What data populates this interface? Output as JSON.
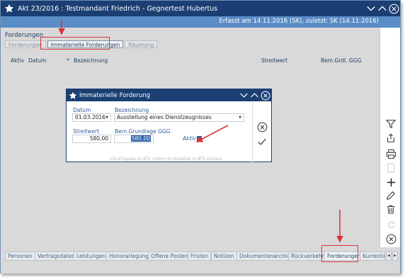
{
  "window": {
    "title": "Akt 23/2016 : Testmandant Friedrich - Gegnertest Hubertus",
    "info": "Erfasst am 14.11.2016 (SK), zuletzt: SK (14.11.2016)"
  },
  "section": {
    "title": "Forderungen",
    "tabs": [
      "Forderungen",
      "Immaterielle Forderungen",
      "Räumung"
    ]
  },
  "columns": [
    "Aktiv",
    "Datum",
    "Bezeichnung",
    "Streitwert",
    "Bem.Grdl. GGG"
  ],
  "dialog": {
    "title": "Immaterielle Forderung",
    "datum_label": "Datum",
    "datum_value": "01.03.2016",
    "bezeichnung_label": "Bezeichnung",
    "bezeichnung_value": "Ausstellung eines Dienstzeugnisses",
    "streitwert_label": "Streitwert",
    "streitwert_value": "580,00",
    "bem_label": "Bem.Grundlage GGG",
    "bem_value": "580,00",
    "aktiv_label": "Aktiv",
    "aktiv_checked": true,
    "hint": "<S>Eingabe in ATS   <Strg+S>Anzeige in ATS ein/aus"
  },
  "bottom_tabs": [
    "Personen",
    "Vertragsdaten",
    "Leistungen",
    "Honorarlegung",
    "Offene Posten",
    "Fristen",
    "Notizen",
    "Dokumentenarchiv",
    "Rückverkehr",
    "Forderungen",
    "Kurrentien"
  ],
  "bottom_active": "Forderungen",
  "colors": {
    "titlebar": "#1b3f73",
    "infobar": "#5a8cc6",
    "highlight": "#d9343a"
  }
}
